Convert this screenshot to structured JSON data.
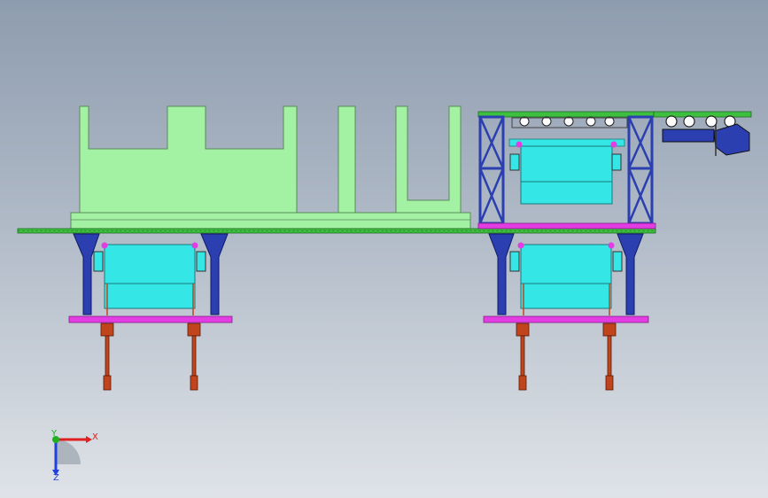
{
  "view": {
    "background_top": "#8e9caf",
    "background_bottom": "#dfe3e8"
  },
  "colors": {
    "platform": "#a3f2a3",
    "rail": "#3fbf3f",
    "frame": "#2b3fb0",
    "cabin": "#35e6e6",
    "magenta": "#e23ce2",
    "anchor": "#c0451c"
  },
  "triad": {
    "x_label": "X",
    "y_label": "Y",
    "z_label": "Z",
    "x_color": "#e02020",
    "y_color": "#20b020",
    "z_color": "#2040e0"
  }
}
